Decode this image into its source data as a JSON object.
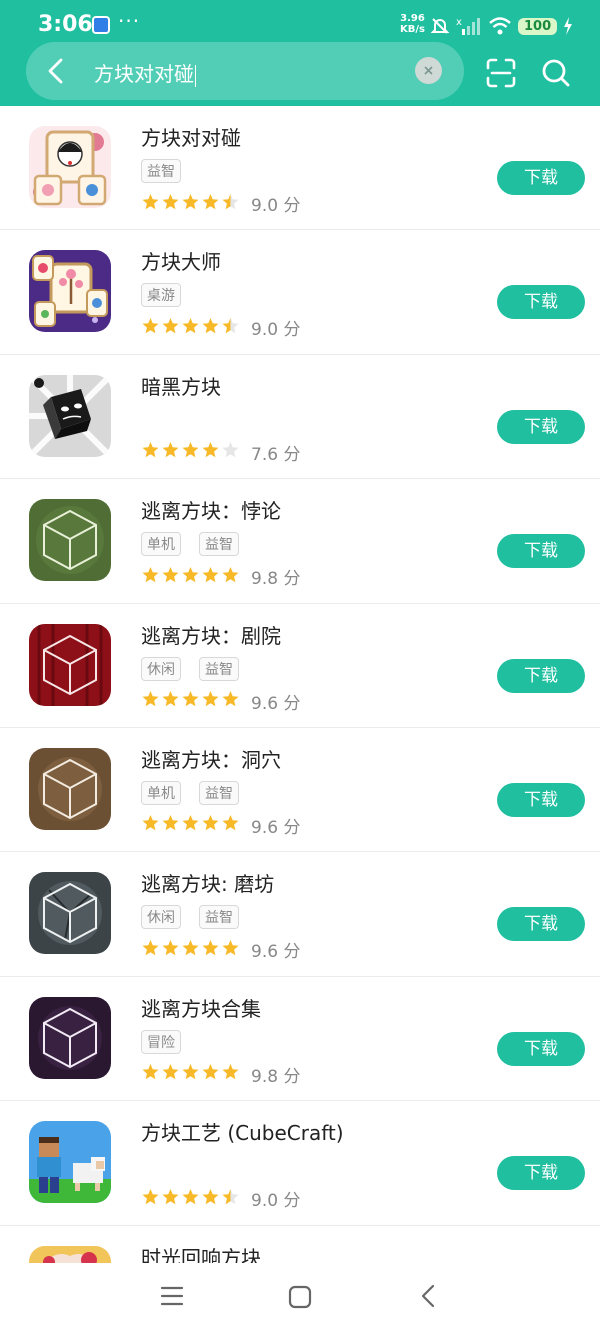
{
  "status_bar": {
    "time": "3:06",
    "speed_value": "3.96",
    "speed_unit": "KB/s",
    "battery": "100"
  },
  "search": {
    "query": "方块对对碰"
  },
  "results": [
    {
      "title": "方块对对碰",
      "tags": [
        "益智"
      ],
      "score": "9.0 分",
      "stars": 4.5,
      "button": "下载"
    },
    {
      "title": "方块大师",
      "tags": [
        "桌游"
      ],
      "score": "9.0 分",
      "stars": 4.5,
      "button": "下载"
    },
    {
      "title": "暗黑方块",
      "tags": [],
      "score": "7.6 分",
      "stars": 4,
      "button": "下载"
    },
    {
      "title": "逃离方块：悖论",
      "tags": [
        "单机",
        "益智"
      ],
      "score": "9.8 分",
      "stars": 5,
      "button": "下载"
    },
    {
      "title": "逃离方块：剧院",
      "tags": [
        "休闲",
        "益智"
      ],
      "score": "9.6 分",
      "stars": 5,
      "button": "下载"
    },
    {
      "title": "逃离方块：洞穴",
      "tags": [
        "单机",
        "益智"
      ],
      "score": "9.6 分",
      "stars": 5,
      "button": "下载"
    },
    {
      "title": "逃离方块: 磨坊",
      "tags": [
        "休闲",
        "益智"
      ],
      "score": "9.6 分",
      "stars": 5,
      "button": "下载"
    },
    {
      "title": "逃离方块合集",
      "tags": [
        "冒险"
      ],
      "score": "9.8 分",
      "stars": 5,
      "button": "下载"
    },
    {
      "title": "方块工艺 (CubeCraft)",
      "tags": [],
      "score": "9.0 分",
      "stars": 4.5,
      "button": "下载"
    },
    {
      "title": "时光回响方块",
      "tags": [],
      "score": "",
      "stars": 0,
      "button": ""
    }
  ],
  "colors": {
    "accent": "#20bfa0",
    "star": "#f7b928",
    "star_empty": "#e6e6e6"
  }
}
